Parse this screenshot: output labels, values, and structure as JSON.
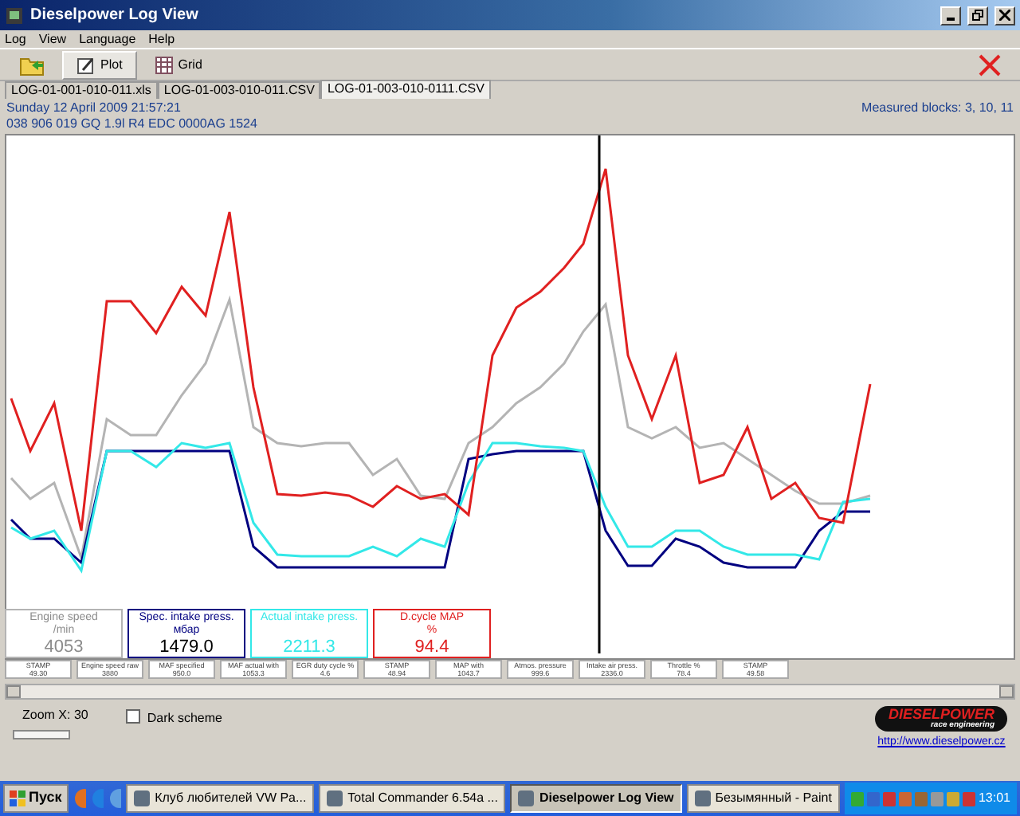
{
  "window": {
    "title": "Dieselpower Log View"
  },
  "menu": [
    "Log",
    "View",
    "Language",
    "Help"
  ],
  "toolbar": [
    {
      "label": "Plot",
      "selected": true
    },
    {
      "label": "Grid",
      "selected": false
    }
  ],
  "file_tabs": [
    {
      "label": "LOG-01-001-010-011.xls",
      "selected": false
    },
    {
      "label": "LOG-01-003-010-011.CSV",
      "selected": false
    },
    {
      "label": "LOG-01-003-010-0111.CSV",
      "selected": true
    }
  ],
  "info": {
    "date": "Sunday 12 April 2009 21:57:21",
    "ecu": "038 906 019 GQ  1.9l R4 EDC 0000AG  1524",
    "blocks": "Measured blocks: 3, 10, 11"
  },
  "gauges": [
    {
      "name": "Engine speed",
      "unit": "/min",
      "value": "4053",
      "color": "#b4b4b4"
    },
    {
      "name": "Spec. intake press.",
      "unit": "мбар",
      "value": "1479.0",
      "color": "#000080"
    },
    {
      "name": "Actual intake press.",
      "value": "2211.3",
      "color": "#33e8e8"
    },
    {
      "name": "D.cycle MAP",
      "unit": "%",
      "value": "94.4",
      "color": "#e02020"
    }
  ],
  "channels": [
    {
      "name": "STAMP",
      "value": "49.30"
    },
    {
      "name": "Engine speed raw",
      "value": "3880"
    },
    {
      "name": "MAF specified",
      "value": "950.0"
    },
    {
      "name": "MAF actual with",
      "value": "1053.3"
    },
    {
      "name": "EGR duty cycle %",
      "value": "4.6"
    },
    {
      "name": "STAMP",
      "value": "48.94"
    },
    {
      "name": "MAP with",
      "value": "1043.7"
    },
    {
      "name": "Atmos. pressure",
      "value": "999.6"
    },
    {
      "name": "Intake air press.",
      "value": "2336.0"
    },
    {
      "name": "Throttle %",
      "value": "78.4"
    },
    {
      "name": "STAMP",
      "value": "49.58"
    }
  ],
  "zoom": {
    "label": "Zoom X: 30",
    "level": 0.97
  },
  "dark_scheme": {
    "label": "Dark scheme",
    "checked": false
  },
  "logo": {
    "brand": "DIESELPOWER",
    "tagline": "race engineering",
    "link": "http://www.dieselpower.cz"
  },
  "taskbar": {
    "start": "Пуск",
    "tasks": [
      {
        "label": "Клуб любителей VW Pa...",
        "selected": false
      },
      {
        "label": "Total Commander 6.54a ...",
        "selected": false
      },
      {
        "label": "Dieselpower Log View",
        "selected": true
      },
      {
        "label": "Безымянный - Paint",
        "selected": false
      }
    ],
    "clock": "13:01"
  }
}
